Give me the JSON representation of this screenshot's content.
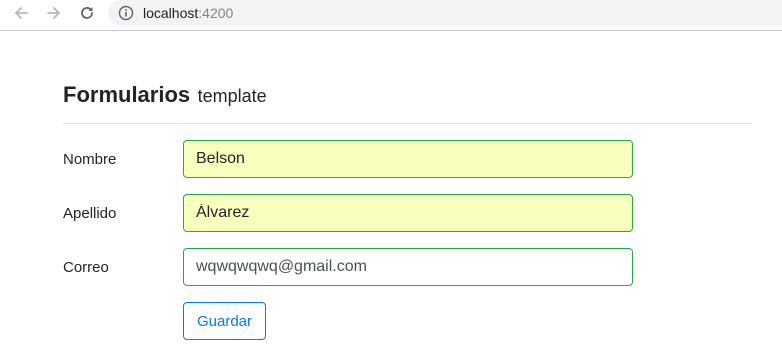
{
  "browser": {
    "url_host": "localhost",
    "url_port": ":4200"
  },
  "form": {
    "title": "Formularios",
    "subtitle": "template",
    "fields": [
      {
        "label": "Nombre",
        "value": "Belson"
      },
      {
        "label": "Apellido",
        "value": "Álvarez"
      },
      {
        "label": "Correo",
        "value": "wqwqwqwq@gmail.com"
      }
    ],
    "submit_label": "Guardar"
  },
  "colors": {
    "valid_border": "#28a745",
    "autofill_background": "#faffbd",
    "primary": "#007bff"
  }
}
